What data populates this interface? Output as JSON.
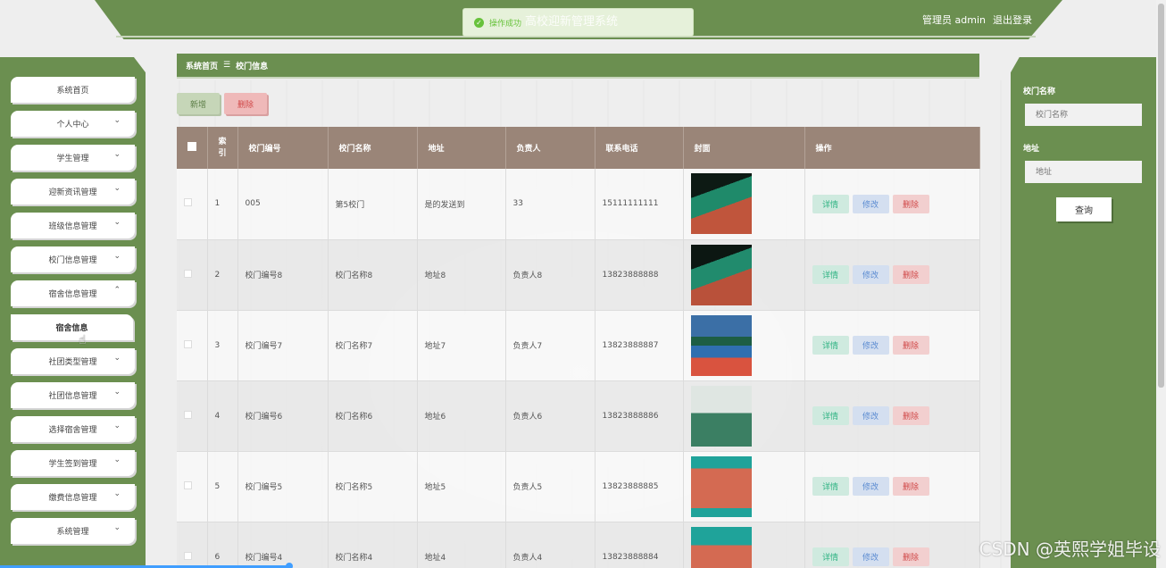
{
  "header": {
    "title": "高校迎新管理系统",
    "user_label": "管理员 admin",
    "logout": "退出登录"
  },
  "toast": {
    "message": "操作成功"
  },
  "sidebar": {
    "items": [
      {
        "label": "系统首页",
        "chevron": ""
      },
      {
        "label": "个人中心",
        "chevron": "⌄"
      },
      {
        "label": "学生管理",
        "chevron": "⌄"
      },
      {
        "label": "迎新资讯管理",
        "chevron": "⌄"
      },
      {
        "label": "班级信息管理",
        "chevron": "⌄"
      },
      {
        "label": "校门信息管理",
        "chevron": "⌄"
      },
      {
        "label": "宿舍信息管理",
        "chevron": "⌃"
      },
      {
        "label": "宿舍信息",
        "chevron": ""
      },
      {
        "label": "社团类型管理",
        "chevron": "⌄"
      },
      {
        "label": "社团信息管理",
        "chevron": "⌄"
      },
      {
        "label": "选择宿舍管理",
        "chevron": "⌄"
      },
      {
        "label": "学生签到管理",
        "chevron": "⌄"
      },
      {
        "label": "缴费信息管理",
        "chevron": "⌄"
      },
      {
        "label": "系统管理",
        "chevron": "⌄"
      }
    ]
  },
  "breadcrumb": {
    "home": "系统首页",
    "sep": "☰",
    "current": "校门信息"
  },
  "toolbar": {
    "add": "新增",
    "delete": "删除"
  },
  "table": {
    "headers": [
      "索引",
      "校门编号",
      "校门名称",
      "地址",
      "负责人",
      "联系电话",
      "封面",
      "操作"
    ],
    "index_header_line1": "索",
    "index_header_line2": "引",
    "ops": {
      "detail": "详情",
      "edit": "修改",
      "delete": "删除"
    },
    "rows": [
      {
        "index": "1",
        "code": "005",
        "name": "第5校门",
        "address": "是的发送到",
        "manager": "33",
        "phone": "15111111111"
      },
      {
        "index": "2",
        "code": "校门编号8",
        "name": "校门名称8",
        "address": "地址8",
        "manager": "负责人8",
        "phone": "13823888888"
      },
      {
        "index": "3",
        "code": "校门编号7",
        "name": "校门名称7",
        "address": "地址7",
        "manager": "负责人7",
        "phone": "13823888887"
      },
      {
        "index": "4",
        "code": "校门编号6",
        "name": "校门名称6",
        "address": "地址6",
        "manager": "负责人6",
        "phone": "13823888886"
      },
      {
        "index": "5",
        "code": "校门编号5",
        "name": "校门名称5",
        "address": "地址5",
        "manager": "负责人5",
        "phone": "13823888885"
      },
      {
        "index": "6",
        "code": "校门编号4",
        "name": "校门名称4",
        "address": "地址4",
        "manager": "负责人4",
        "phone": "13823888884"
      }
    ]
  },
  "search": {
    "name_label": "校门名称",
    "name_placeholder": "校门名称",
    "address_label": "地址",
    "address_placeholder": "地址",
    "submit": "查询"
  },
  "watermark": "CSDN @英熙学姐毕设",
  "colors": {
    "primary_green": "#6b8f50",
    "table_header": "#9a8578"
  }
}
